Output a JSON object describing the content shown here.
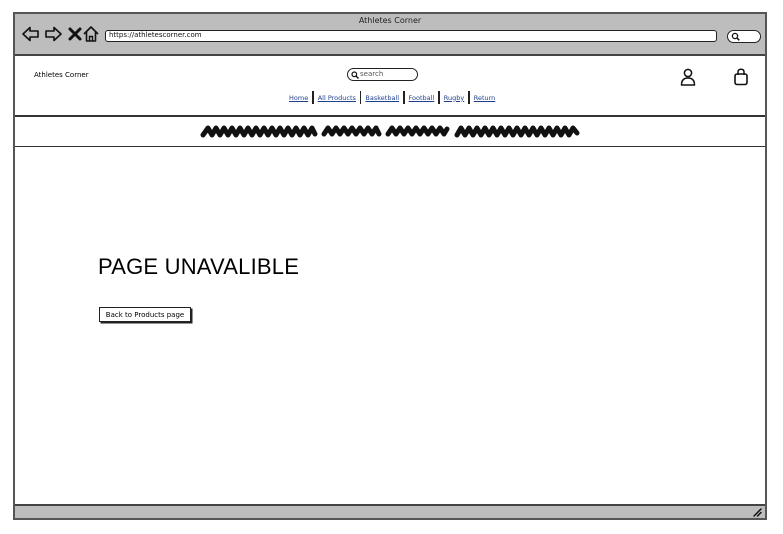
{
  "window": {
    "title": "Athletes Corner",
    "url": "https://athletescorner.com"
  },
  "header": {
    "brand": "Athletes Corner",
    "search_placeholder": "search",
    "nav": [
      "Home",
      "All Products",
      "Basketball",
      "Football",
      "Rugby",
      "Return"
    ]
  },
  "main": {
    "heading": "PAGE UNAVALIBLE",
    "back_button": "Back to Products page"
  },
  "icons": {
    "back": "arrow-left-icon",
    "forward": "arrow-right-icon",
    "stop": "close-icon",
    "home": "home-icon",
    "search": "search-icon",
    "account": "user-icon",
    "bag": "shopping-bag-icon",
    "resize": "resize-grip-icon"
  }
}
